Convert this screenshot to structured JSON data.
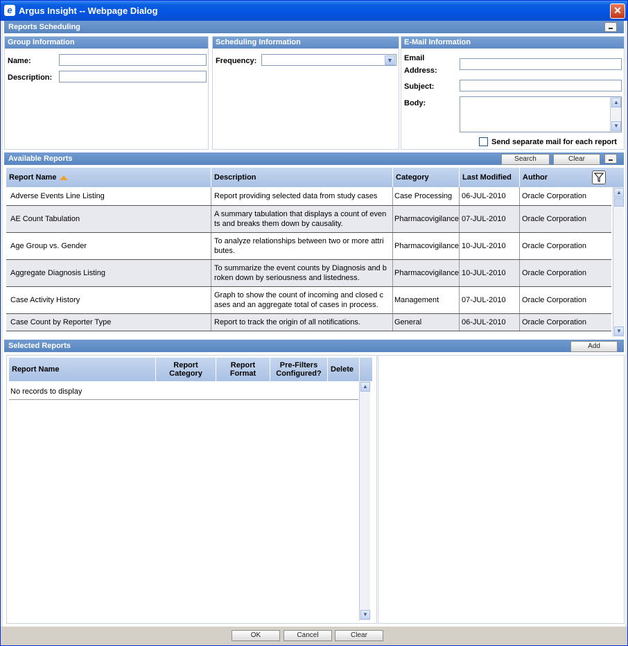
{
  "window": {
    "title": "Argus Insight -- Webpage Dialog",
    "close_label": "✕"
  },
  "reports_scheduling": {
    "title": "Reports Scheduling"
  },
  "group_info": {
    "title": "Group Information",
    "name_label": "Name:",
    "name_value": "",
    "description_label": "Description:",
    "description_value": ""
  },
  "scheduling_info": {
    "title": "Scheduling Information",
    "frequency_label": "Frequency:",
    "frequency_value": ""
  },
  "email_info": {
    "title": "E-Mail Information",
    "email_label_1": "Email",
    "email_label_2": "Address:",
    "email_value": "",
    "subject_label": "Subject:",
    "subject_value": "",
    "body_label": "Body:",
    "body_value": "",
    "separate_mail_label": "Send separate mail for each report"
  },
  "available_reports": {
    "title": "Available Reports",
    "search_label": "Search",
    "clear_label": "Clear",
    "columns": [
      "Report Name",
      "Description",
      "Category",
      "Last Modified",
      "Author"
    ],
    "rows": [
      {
        "name": "Adverse Events Line Listing",
        "description": "Report providing selected data from study cases",
        "category": "Case Processing",
        "modified": "06-JUL-2010",
        "author": "Oracle Corporation"
      },
      {
        "name": "AE Count Tabulation",
        "description": "A summary tabulation that displays a count of even ts and breaks them down by causality.",
        "category": "Pharmacovigilance",
        "modified": "07-JUL-2010",
        "author": "Oracle Corporation"
      },
      {
        "name": "Age Group vs. Gender",
        "description": "To analyze relationships between two or more attri butes.",
        "category": "Pharmacovigilance",
        "modified": "10-JUL-2010",
        "author": "Oracle Corporation"
      },
      {
        "name": "Aggregate Diagnosis Listing",
        "description": "To summarize the event counts by Diagnosis and b roken down by seriousness and listedness.",
        "category": "Pharmacovigilance",
        "modified": "10-JUL-2010",
        "author": "Oracle Corporation"
      },
      {
        "name": "Case Activity History",
        "description": "Graph to show the count of incoming and closed c ases and an aggregate total of cases in process.",
        "category": "Management",
        "modified": "07-JUL-2010",
        "author": "Oracle Corporation"
      },
      {
        "name": "Case Count by Reporter Type",
        "description": "Report to track the origin of all notifications.",
        "category": "General",
        "modified": "06-JUL-2010",
        "author": "Oracle Corporation"
      }
    ]
  },
  "selected_reports": {
    "title": "Selected Reports",
    "add_label": "Add",
    "col_name": "Report Name",
    "col_category_1": "Report",
    "col_category_2": "Category",
    "col_format_1": "Report",
    "col_format_2": "Format",
    "col_prefilters_1": "Pre-Filters",
    "col_prefilters_2": "Configured?",
    "col_delete": "Delete",
    "empty_message": "No records to display"
  },
  "footer": {
    "ok_label": "OK",
    "cancel_label": "Cancel",
    "clear_label": "Clear"
  }
}
